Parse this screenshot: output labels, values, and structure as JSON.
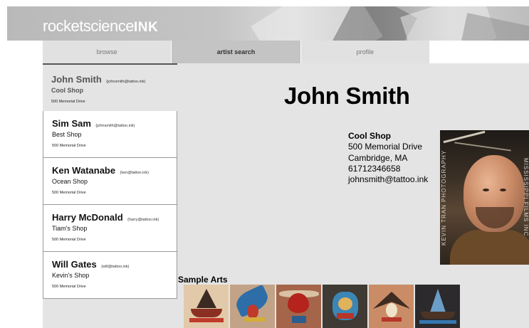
{
  "header": {
    "logo_part1": "rocketscience",
    "logo_part2": "INK"
  },
  "nav": {
    "tabs": [
      {
        "label": "browse",
        "active": false
      },
      {
        "label": "artist search",
        "active": true
      },
      {
        "label": "profile",
        "active": false
      }
    ]
  },
  "artists": [
    {
      "name": "John Smith",
      "email": "(johnsmith@tattoo.ink)",
      "shop": "Cool Shop",
      "address": "500 Memorial Drive",
      "selected": true
    },
    {
      "name": "Sim Sam",
      "email": "(johnsmith@tattoo.ink)",
      "shop": "Best Shop",
      "address": "500 Memorial Drive",
      "selected": false
    },
    {
      "name": "Ken Watanabe",
      "email": "(ken@tattoo.ink)",
      "shop": "Ocean Shop",
      "address": "500 Memorial Drive",
      "selected": false
    },
    {
      "name": "Harry McDonald",
      "email": "(harry@tattoo.ink)",
      "shop": "Tiam's Shop",
      "address": "500 Memorial Drive",
      "selected": false
    },
    {
      "name": "Will Gates",
      "email": "(will@tattoo.ink)",
      "shop": "Kevin's Shop",
      "address": "500 Memorial Drive",
      "selected": false
    }
  ],
  "profile": {
    "name": "John Smith",
    "shop": "Cool Shop",
    "address": "500 Memorial Drive",
    "city": "Cambridge, MA",
    "phone": "61712346658",
    "email": "johnsmith@tattoo.ink",
    "photo_watermark_left": "KEVIN TRAN PHOTOGRAPHY",
    "photo_watermark_right": "MISSISSIPPI FILMS INC"
  },
  "sample_arts": {
    "title": "Sample Arts",
    "items": [
      "ship-tattoo",
      "swallow-tattoo",
      "chest-piece-tattoo",
      "lady-portrait-tattoo",
      "eagle-tattoo",
      "clipper-ship-tattoo"
    ]
  },
  "colors": {
    "main_bg": "#e4e4e4",
    "active_tab": "#c4c4c4",
    "inactive_tab": "#e1e1e1"
  }
}
